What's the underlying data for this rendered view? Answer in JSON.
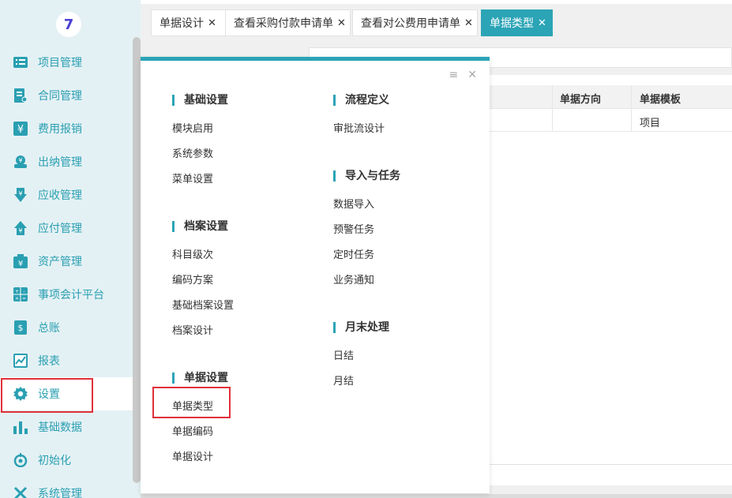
{
  "colors": {
    "accent": "#2ba4b6",
    "sidebar_bg": "#e4f1f4",
    "highlight": "#e0303a"
  },
  "logo": {
    "glyph": "7"
  },
  "sidebar": {
    "items": [
      {
        "label": "项目管理",
        "icon": "list-icon"
      },
      {
        "label": "合同管理",
        "icon": "contract-icon"
      },
      {
        "label": "费用报销",
        "icon": "yen-receipt-icon"
      },
      {
        "label": "出纳管理",
        "icon": "cashier-icon"
      },
      {
        "label": "应收管理",
        "icon": "receivable-icon"
      },
      {
        "label": "应付管理",
        "icon": "payable-icon"
      },
      {
        "label": "资产管理",
        "icon": "asset-icon"
      },
      {
        "label": "事项会计平台",
        "icon": "calculator-icon"
      },
      {
        "label": "总账",
        "icon": "ledger-icon"
      },
      {
        "label": "报表",
        "icon": "report-icon"
      },
      {
        "label": "设置",
        "icon": "gear-icon"
      },
      {
        "label": "基础数据",
        "icon": "bar-chart-icon"
      },
      {
        "label": "初始化",
        "icon": "power-icon"
      },
      {
        "label": "系统管理",
        "icon": "tools-icon"
      }
    ]
  },
  "tabs": [
    {
      "label": "单据设计",
      "close": "✕"
    },
    {
      "label": "查看采购付款申请单",
      "close": "✕"
    },
    {
      "label": "查看对公费用申请单",
      "close": "✕"
    },
    {
      "label": "单据类型",
      "close": "✕"
    }
  ],
  "grid": {
    "headers": [
      "单据方向",
      "单据模板"
    ],
    "row": {
      "template": "项目"
    }
  },
  "popup": {
    "controls": {
      "menu": "≡",
      "close": "✕"
    },
    "left": [
      {
        "title": "基础设置",
        "items": [
          "模块启用",
          "系统参数",
          "菜单设置"
        ]
      },
      {
        "title": "档案设置",
        "items": [
          "科目级次",
          "编码方案",
          "基础档案设置",
          "档案设计"
        ]
      },
      {
        "title": "单据设置",
        "items": [
          "单据类型",
          "单据编码",
          "单据设计"
        ]
      }
    ],
    "right": [
      {
        "title": "流程定义",
        "items": [
          "审批流设计"
        ]
      },
      {
        "title": "导入与任务",
        "items": [
          "数据导入",
          "预警任务",
          "定时任务",
          "业务通知"
        ]
      },
      {
        "title": "月末处理",
        "items": [
          "日结",
          "月结"
        ]
      }
    ]
  }
}
